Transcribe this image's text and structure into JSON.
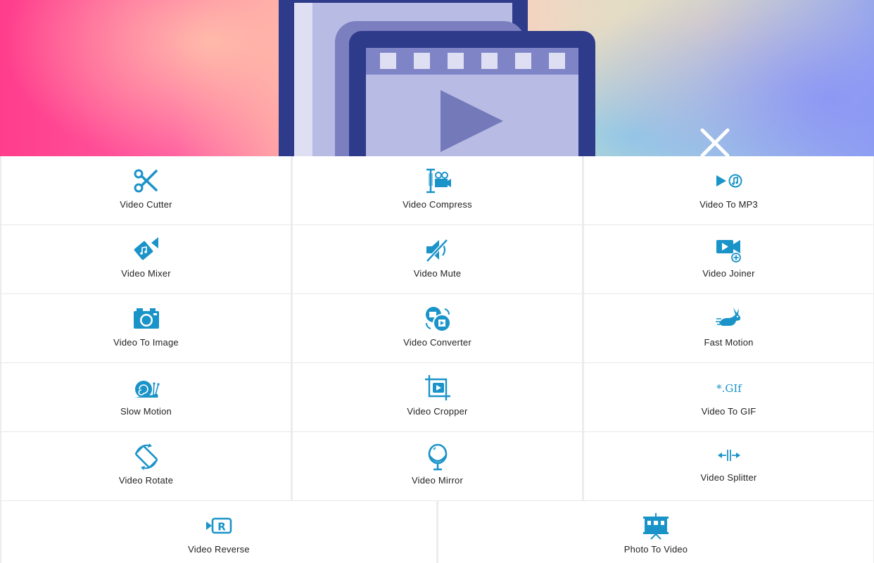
{
  "colors": {
    "accent": "#1a93c9",
    "label": "#222222",
    "divider": "#e8e8e8",
    "logo_dark": "#2e3a8a",
    "logo_light": "#b8bbe4"
  },
  "header": {
    "logo_icon": "video-film-frames-icon",
    "close_icon": "close-icon"
  },
  "tools": [
    {
      "label": "Video Cutter",
      "icon": "scissors-icon"
    },
    {
      "label": "Video Compress",
      "icon": "compress-clamp-icon"
    },
    {
      "label": "Video To MP3",
      "icon": "play-to-music-icon"
    },
    {
      "label": "Video Mixer",
      "icon": "music-camera-icon"
    },
    {
      "label": "Video Mute",
      "icon": "speaker-muted-icon"
    },
    {
      "label": "Video Joiner",
      "icon": "camera-add-icon"
    },
    {
      "label": "Video To Image",
      "icon": "photo-camera-icon"
    },
    {
      "label": "Video Converter",
      "icon": "convert-circles-icon"
    },
    {
      "label": "Fast Motion",
      "icon": "rabbit-icon"
    },
    {
      "label": "Slow Motion",
      "icon": "snail-icon"
    },
    {
      "label": "Video Cropper",
      "icon": "crop-play-icon"
    },
    {
      "label": "Video To GIF",
      "icon": "gif-text-icon"
    },
    {
      "label": "Video Rotate",
      "icon": "rotate-device-icon"
    },
    {
      "label": "Video Mirror",
      "icon": "mirror-icon"
    },
    {
      "label": "Video Splitter",
      "icon": "split-arrows-icon"
    },
    {
      "label": "Video Reverse",
      "icon": "reverse-r-icon"
    },
    {
      "label": "Photo To Video",
      "icon": "slideshow-icon"
    }
  ]
}
